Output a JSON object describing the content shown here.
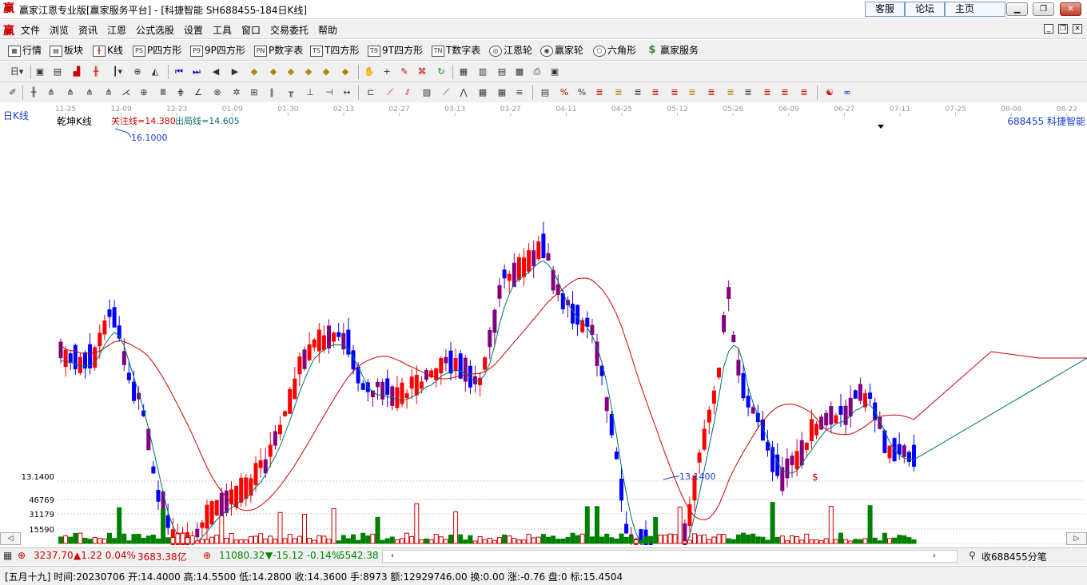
{
  "window": {
    "title": "赢家江恩专业版[赢家服务平台] - [科捷智能  SH688455-184日K线]",
    "links": [
      "客服",
      "论坛",
      "主页"
    ]
  },
  "menu": {
    "items": [
      "文件",
      "浏览",
      "资讯",
      "江恩",
      "公式选股",
      "设置",
      "工具",
      "窗口",
      "交易委托",
      "帮助"
    ]
  },
  "nav": {
    "items": [
      {
        "icon": "grid-icon",
        "label": "行情"
      },
      {
        "icon": "blocks-icon",
        "label": "板块"
      },
      {
        "icon": "candlestick-icon",
        "label": "K线"
      },
      {
        "icon": "p-square-icon",
        "label": "P四方形",
        "badge": "PS"
      },
      {
        "icon": "p9-square-icon",
        "label": "9P四方形",
        "badge": "P9"
      },
      {
        "icon": "p-number-icon",
        "label": "P数字表",
        "badge": "PN"
      },
      {
        "icon": "t-square-icon",
        "label": "T四方形",
        "badge": "TS"
      },
      {
        "icon": "t9-square-icon",
        "label": "9T四方形",
        "badge": "T9"
      },
      {
        "icon": "t-number-icon",
        "label": "T数字表",
        "badge": "TN"
      },
      {
        "icon": "gann-wheel-icon",
        "label": "江恩轮"
      },
      {
        "icon": "winner-wheel-icon",
        "label": "赢家轮"
      },
      {
        "icon": "hexagon-icon",
        "label": "六角形"
      },
      {
        "icon": "dollar-icon",
        "label": "赢家服务"
      }
    ]
  },
  "chart": {
    "period": "日K线",
    "indicator": "乾坤K线",
    "line1_label": "关注线=14.380",
    "line2_label": "出局线=14.605",
    "stock": "688455 科捷智能",
    "max_label": "16.1000",
    "min_label": "13.1400",
    "left_price_label": "13.1400",
    "dollar_marker": "$",
    "volume_axis": [
      "46769",
      "31179",
      "15590"
    ],
    "colors": {
      "up": "#ff0000",
      "down": "#0000ff",
      "mixed": "#800080",
      "volume": "#008000",
      "line1": "#cc0000",
      "line2": "#007070"
    }
  },
  "chart_data": {
    "type": "candlestick",
    "title": "科捷智能 688455 日K线",
    "x_ticks": [
      "11-25",
      "12-09",
      "12-23",
      "01-09",
      "01-30",
      "02-13",
      "02-27",
      "03-13",
      "03-27",
      "04-11",
      "04-25",
      "05-12",
      "05-26",
      "06-09",
      "06-27",
      "07-11",
      "07-25",
      "08-08",
      "08-22"
    ],
    "price_high_marker": 16.1,
    "price_low_marker": 13.14,
    "last_line1": 14.38,
    "last_line2": 14.605
  },
  "tickers": [
    {
      "value": "3237.70",
      "change": "▲1.22 0.04%",
      "amount": "3683.38亿",
      "dir": "up"
    },
    {
      "value": "11080.32",
      "change": "▼-15.12 -0.14%",
      "amount": "5542.38",
      "dir": "down"
    }
  ],
  "watch_label": "收688455分笔",
  "info_bar": "[五月十九] 时间:20230706 开:14.4000 高:14.5500 低:14.2800 收:14.3600 手:8973 额:12929746.00 换:0.00 涨:-0.76 盘:0 标:15.4504"
}
